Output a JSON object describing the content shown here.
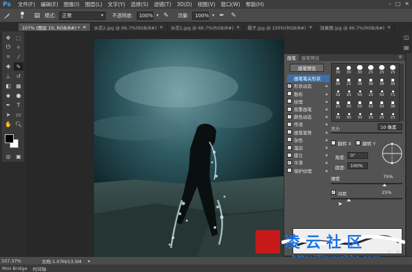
{
  "menubar": {
    "logo": "Ps",
    "items": [
      "文件(F)",
      "编辑(E)",
      "图像(I)",
      "图层(L)",
      "文字(Y)",
      "选择(S)",
      "滤镜(T)",
      "3D(D)",
      "视图(V)",
      "窗口(W)",
      "帮助(H)"
    ],
    "window_controls": [
      "–",
      "□",
      "✕"
    ]
  },
  "optionsbar": {
    "brush_size": "8",
    "mode_label": "模式:",
    "mode_value": "正常",
    "opacity_label": "不透明度:",
    "opacity_value": "100%",
    "flow_label": "流量:",
    "flow_value": "100%"
  },
  "tabs": [
    {
      "label": "107% (图层 10, RGB/8#) *",
      "close": "✕"
    },
    {
      "label": "水花2.jpg @ 66.7%(RGB/8#)",
      "close": "✕"
    },
    {
      "label": "水花1.jpg @ 66.7%(RGB/8#)",
      "close": "✕"
    },
    {
      "label": "帽子.jpg @ 100%(RGB/8#)",
      "close": "✕"
    },
    {
      "label": "效果图.jpg @ 66.7%(RGB/8#)",
      "close": "✕"
    }
  ],
  "brush_panel": {
    "tabs": [
      "画笔",
      "画笔预设"
    ],
    "preset_button": "画笔预设",
    "options": [
      {
        "label": "画笔笔尖形状",
        "checked": false,
        "highlight": true
      },
      {
        "label": "形状动态",
        "checked": true,
        "highlight": false
      },
      {
        "label": "散布",
        "checked": false,
        "highlight": false
      },
      {
        "label": "纹理",
        "checked": false,
        "highlight": false
      },
      {
        "label": "双重画笔",
        "checked": false,
        "highlight": false
      },
      {
        "label": "颜色动态",
        "checked": false,
        "highlight": false
      },
      {
        "label": "传递",
        "checked": false,
        "highlight": false
      },
      {
        "label": "画笔笔势",
        "checked": false,
        "highlight": false
      },
      {
        "label": "杂色",
        "checked": false,
        "highlight": false
      },
      {
        "label": "湿边",
        "checked": false,
        "highlight": false
      },
      {
        "label": "建立",
        "checked": false,
        "highlight": false
      },
      {
        "label": "平滑",
        "checked": true,
        "highlight": false
      },
      {
        "label": "保护纹理",
        "checked": false,
        "highlight": false
      }
    ],
    "brush_sizes": [
      "30",
      "30",
      "30",
      "25",
      "25",
      "25",
      "36",
      "25",
      "36",
      "36",
      "36",
      "36",
      "32",
      "25",
      "50",
      "25",
      "50",
      "71",
      "25",
      "50",
      "50",
      "50",
      "50",
      "36",
      "30",
      "30",
      "30",
      "25",
      "25",
      "25"
    ],
    "size_label": "大小",
    "size_value": "10 像素",
    "flip_x": "翻转 X",
    "flip_y": "翻转 Y",
    "angle_label": "角度:",
    "angle_value": "0°",
    "roundness_label": "圆度:",
    "roundness_value": "100%",
    "hardness_label": "硬度",
    "hardness_percent": "75%",
    "spacing_label": "间距",
    "spacing_value": "25%"
  },
  "status": {
    "zoom": "107.37%",
    "doc": "文档:1.07M/13.5M",
    "bridge": "Mini Bridge",
    "timeline": "时间轴"
  },
  "watermark": {
    "text": "凌云社区",
    "url": "http://linyunbbs.com"
  },
  "colors": {
    "accent": "#3d6fa8",
    "watermark_blue": "#1a73e6",
    "watermark_red": "#c61a1a"
  }
}
